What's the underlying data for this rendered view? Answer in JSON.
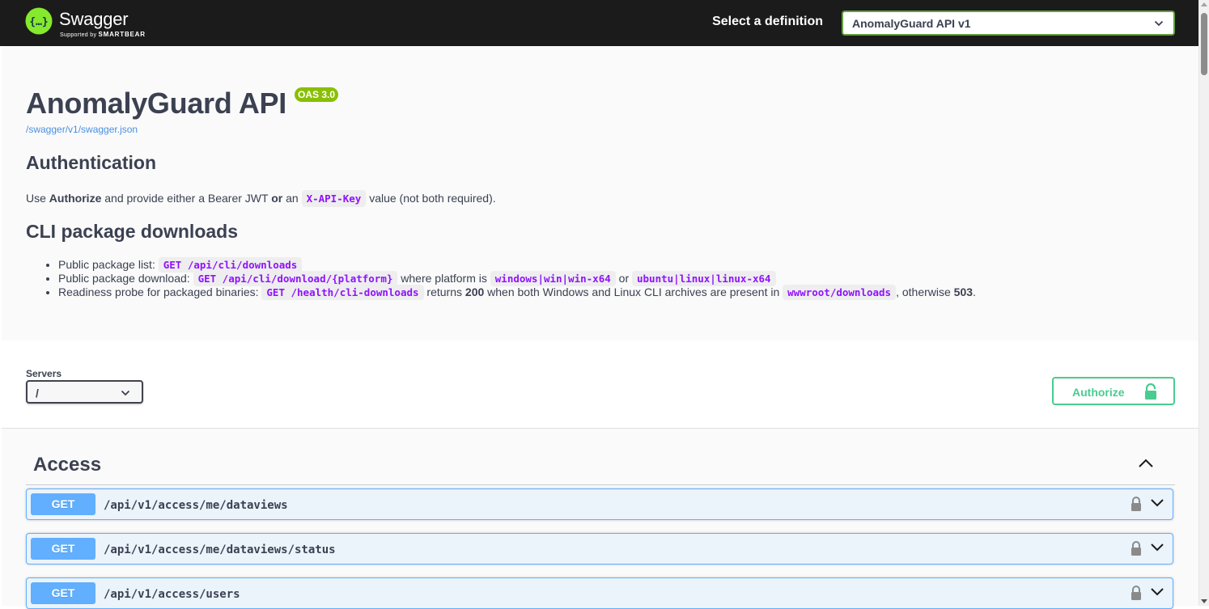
{
  "topbar": {
    "brand": "Swagger",
    "brand_sub_prefix": "Supported by",
    "brand_sub_company": "SMARTBEAR",
    "definition_label": "Select a definition",
    "definition_value": "AnomalyGuard API v1"
  },
  "info": {
    "title": "AnomalyGuard API",
    "version_badge": "OAS 3.0",
    "spec_url": "/swagger/v1/swagger.json",
    "auth_heading": "Authentication",
    "auth_text": {
      "t1": "Use ",
      "b1": "Authorize",
      "t2": " and provide either a Bearer JWT ",
      "b2": "or",
      "t3": " an ",
      "code1": "X-API-Key",
      "t4": " value (not both required)."
    },
    "cli_heading": "CLI package downloads",
    "cli_items": [
      {
        "t1": "Public package list: ",
        "code1": "GET /api/cli/downloads"
      },
      {
        "t1": "Public package download: ",
        "code1": "GET /api/cli/download/{platform}",
        "t2": " where platform is ",
        "code2": "windows|win|win-x64",
        "t3": " or ",
        "code3": "ubuntu|linux|linux-x64"
      },
      {
        "t1": "Readiness probe for packaged binaries: ",
        "code1": "GET /health/cli-downloads",
        "t2": " returns ",
        "b1": "200",
        "t3": " when both Windows and Linux CLI archives are present in ",
        "code2": "wwwroot/downloads",
        "t4": ", otherwise ",
        "b2": "503",
        "t5": "."
      }
    ]
  },
  "servers": {
    "label": "Servers",
    "selected": "/"
  },
  "authorize_label": "Authorize",
  "tags": [
    {
      "name": "Access",
      "operations": [
        {
          "method": "GET",
          "path": "/api/v1/access/me/dataviews"
        },
        {
          "method": "GET",
          "path": "/api/v1/access/me/dataviews/status"
        },
        {
          "method": "GET",
          "path": "/api/v1/access/users"
        }
      ]
    }
  ],
  "colors": {
    "topbar_bg": "#1b1b1b",
    "accent_green": "#49cc90",
    "badge_green": "#89bf04",
    "get_blue": "#61affe",
    "code_purple": "#9012fe",
    "link_blue": "#4990e2"
  },
  "icons": [
    "swagger-logo-icon",
    "chevron-down-icon",
    "lock-icon",
    "chevron-up-icon"
  ]
}
